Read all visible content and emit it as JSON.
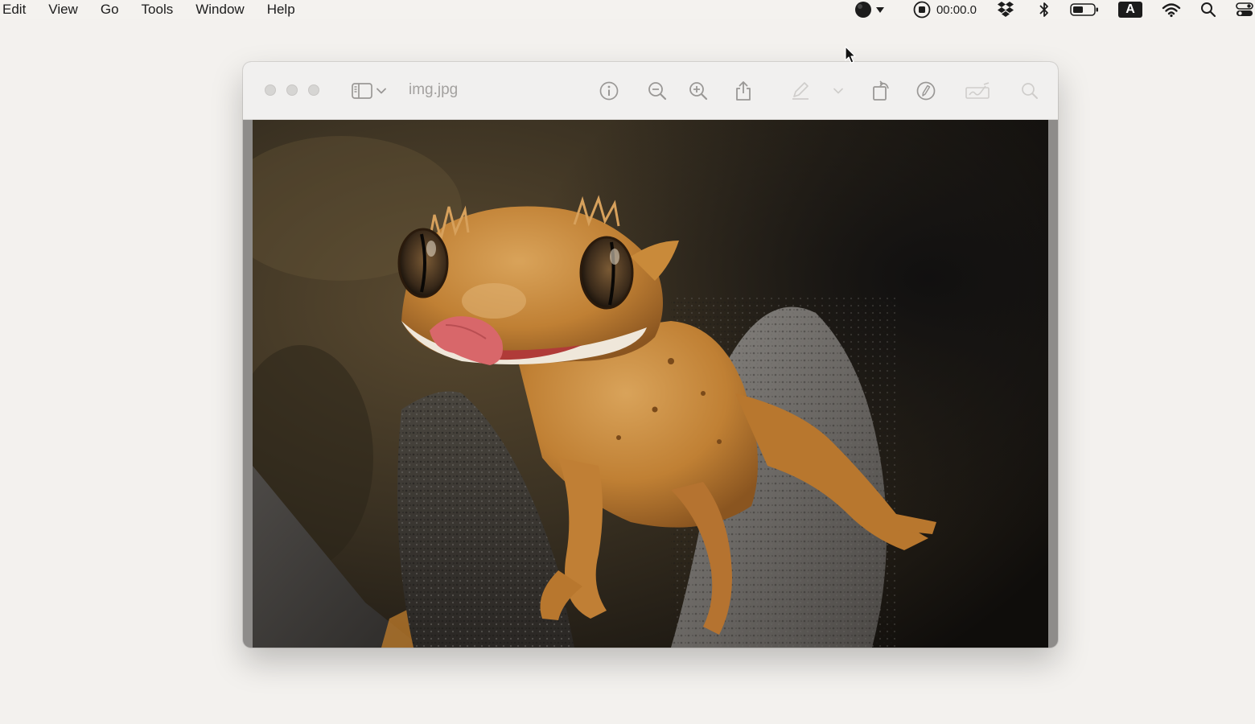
{
  "menubar": {
    "items": [
      "Edit",
      "View",
      "Go",
      "Tools",
      "Window",
      "Help"
    ],
    "recording_time": "00:00.0",
    "keyboard_input": "A",
    "status_icons": [
      "screen-record-menu-icon",
      "record-stop-icon",
      "dropbox-icon",
      "bluetooth-icon",
      "battery-icon",
      "input-source-icon",
      "wifi-icon",
      "spotlight-search-icon",
      "control-center-icon"
    ]
  },
  "window": {
    "title": "img.jpg",
    "toolbar_icons": [
      "sidebar-toggle-icon",
      "chevron-down-icon",
      "info-icon",
      "zoom-out-icon",
      "zoom-in-icon",
      "share-icon",
      "markup-pen-icon",
      "chevron-down-icon",
      "rotate-icon",
      "markup-toolbar-icon",
      "signature-icon",
      "search-icon"
    ]
  },
  "image": {
    "subject": "crested-gecko-photo"
  },
  "colors": {
    "desktop": "#f3f1ee",
    "titlebar": "#f1f0ef",
    "toolbar_icon": "#9a9896",
    "gecko": "#c98a3a"
  }
}
